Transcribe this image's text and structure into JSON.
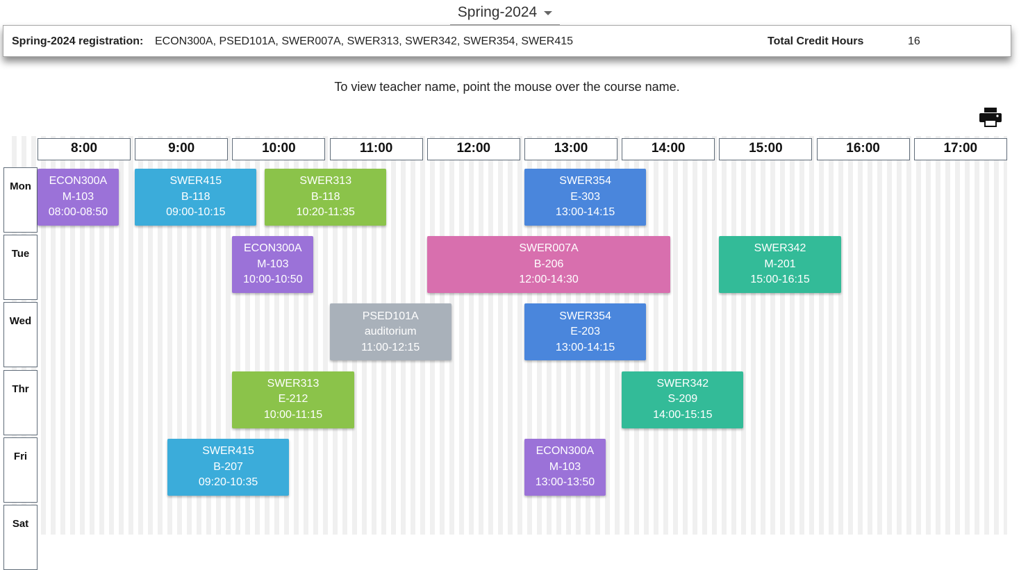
{
  "header": {
    "semester": "Spring-2024",
    "registration_label": "Spring-2024 registration:",
    "registration_courses": "ECON300A, PSED101A, SWER007A, SWER313, SWER342, SWER354, SWER415",
    "total_credit_label": "Total Credit Hours",
    "total_credit_value": "16"
  },
  "hint": "To view teacher name, point the mouse over the course name.",
  "icons": {
    "print": "print-icon"
  },
  "hours": [
    "8:00",
    "9:00",
    "10:00",
    "11:00",
    "12:00",
    "13:00",
    "14:00",
    "15:00",
    "16:00",
    "17:00"
  ],
  "days": [
    "Mon",
    "Tue",
    "Wed",
    "Thr",
    "Fri",
    "Sat"
  ],
  "colors": {
    "ECON300A": "#9b72d8",
    "SWER415": "#3bacda",
    "SWER313": "#8bc34a",
    "SWER354": "#4a86dc",
    "SWER007A": "#d86fae",
    "SWER342": "#33bb98",
    "PSED101A": "#a9b1ba"
  },
  "courses": [
    {
      "day": 0,
      "code": "ECON300A",
      "room": "M-103",
      "time": "08:00-08:50"
    },
    {
      "day": 0,
      "code": "SWER415",
      "room": "B-118",
      "time": "09:00-10:15"
    },
    {
      "day": 0,
      "code": "SWER313",
      "room": "B-118",
      "time": "10:20-11:35"
    },
    {
      "day": 0,
      "code": "SWER354",
      "room": "E-303",
      "time": "13:00-14:15"
    },
    {
      "day": 1,
      "code": "ECON300A",
      "room": "M-103",
      "time": "10:00-10:50"
    },
    {
      "day": 1,
      "code": "SWER007A",
      "room": "B-206",
      "time": "12:00-14:30"
    },
    {
      "day": 1,
      "code": "SWER342",
      "room": "M-201",
      "time": "15:00-16:15"
    },
    {
      "day": 2,
      "code": "PSED101A",
      "room": "auditorium",
      "time": "11:00-12:15"
    },
    {
      "day": 2,
      "code": "SWER354",
      "room": "E-203",
      "time": "13:00-14:15"
    },
    {
      "day": 3,
      "code": "SWER313",
      "room": "E-212",
      "time": "10:00-11:15"
    },
    {
      "day": 3,
      "code": "SWER342",
      "room": "S-209",
      "time": "14:00-15:15"
    },
    {
      "day": 4,
      "code": "SWER415",
      "room": "B-207",
      "time": "09:20-10:35"
    },
    {
      "day": 4,
      "code": "ECON300A",
      "room": "M-103",
      "time": "13:00-13:50"
    }
  ]
}
